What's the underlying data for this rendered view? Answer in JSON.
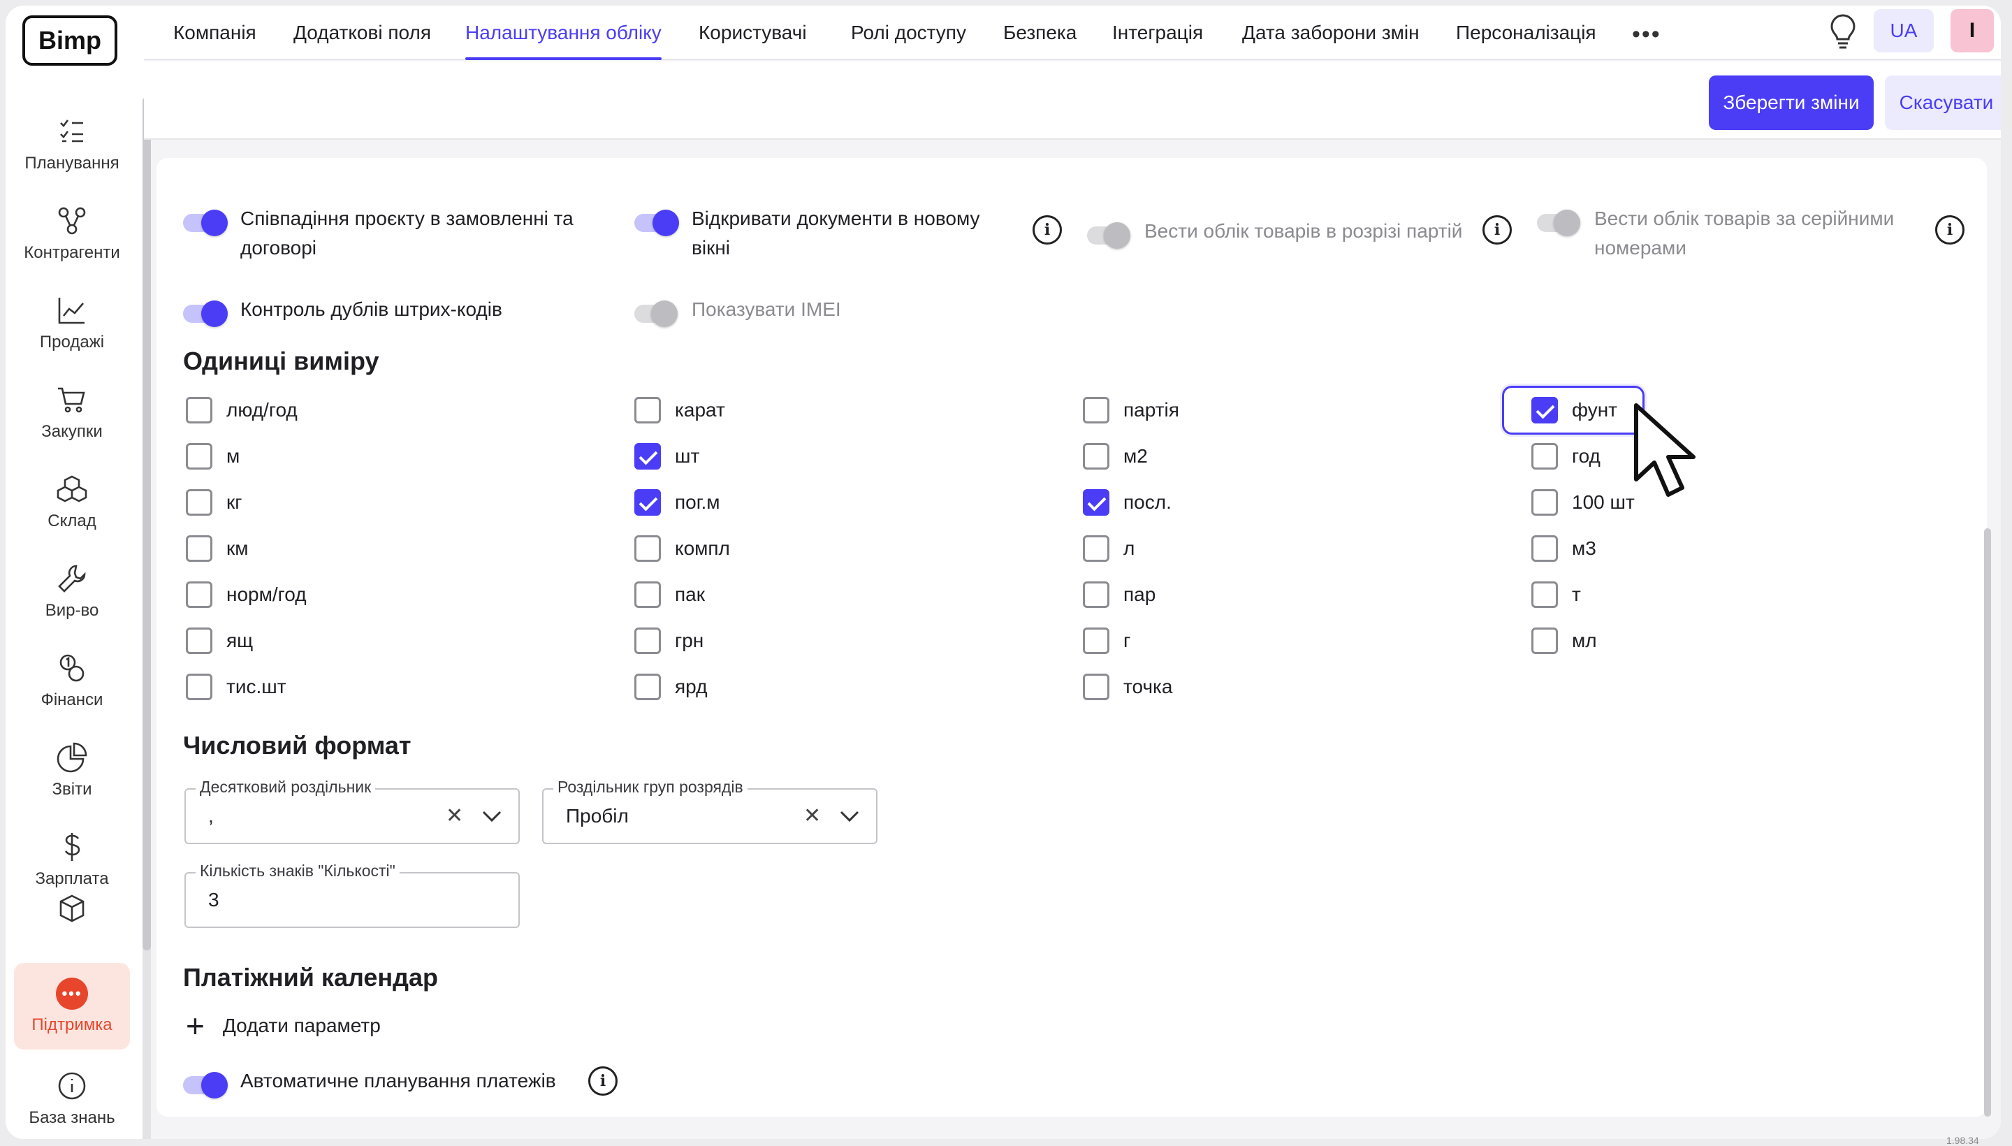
{
  "app": {
    "logo": "Bimp",
    "version": "1.98.34"
  },
  "sidebar": {
    "items": [
      {
        "label": "Планування",
        "icon": "checklist-icon"
      },
      {
        "label": "Контрагенти",
        "icon": "network-icon"
      },
      {
        "label": "Продажі",
        "icon": "chart-line-icon"
      },
      {
        "label": "Закупки",
        "icon": "cart-icon"
      },
      {
        "label": "Склад",
        "icon": "boxes-icon"
      },
      {
        "label": "Вир-во",
        "icon": "wrench-icon"
      },
      {
        "label": "Фінанси",
        "icon": "coins-icon"
      },
      {
        "label": "Звіти",
        "icon": "pie-chart-icon"
      },
      {
        "label": "Зарплата",
        "icon": "dollar-icon"
      },
      {
        "label": "",
        "icon": "cube-icon"
      }
    ],
    "support": {
      "label": "Підтримка",
      "icon": "chat-bubble-icon"
    },
    "knowledge": {
      "label": "База знань",
      "icon": "info-icon"
    }
  },
  "topnav": {
    "tabs": [
      {
        "label": "Компанія"
      },
      {
        "label": "Додаткові поля"
      },
      {
        "label": "Налаштування обліку"
      },
      {
        "label": "Користувачі"
      },
      {
        "label": "Ролі доступу"
      },
      {
        "label": "Безпека"
      },
      {
        "label": "Інтеграція"
      },
      {
        "label": "Дата заборони змін"
      },
      {
        "label": "Персоналізація"
      }
    ],
    "active_tab": "Налаштування обліку",
    "more": "•••",
    "lang": "UA",
    "avatar": "I"
  },
  "actions": {
    "save": "Зберегти зміни",
    "cancel": "Скасувати"
  },
  "toggles": [
    {
      "label": "Співпадіння проєкту в замовленні та договорі",
      "on": true,
      "disabled": false
    },
    {
      "label": "Відкривати документи в новому вікні",
      "on": true,
      "disabled": false,
      "info": true
    },
    {
      "label": "Вести облік товарів в розрізі партій",
      "on": false,
      "disabled": true,
      "info": true
    },
    {
      "label": "Вести облік товарів за серійними номерами",
      "on": false,
      "disabled": true,
      "info": true
    },
    {
      "label": "Контроль дублів штрих-кодів",
      "on": true,
      "disabled": false
    },
    {
      "label": "Показувати IMEI",
      "on": false,
      "disabled": true
    }
  ],
  "units": {
    "title": "Одиниці виміру",
    "columns": [
      [
        {
          "label": "люд/год",
          "checked": false
        },
        {
          "label": "м",
          "checked": false
        },
        {
          "label": "кг",
          "checked": false
        },
        {
          "label": "км",
          "checked": false
        },
        {
          "label": "норм/год",
          "checked": false
        },
        {
          "label": "ящ",
          "checked": false
        },
        {
          "label": "тис.шт",
          "checked": false
        }
      ],
      [
        {
          "label": "карат",
          "checked": false
        },
        {
          "label": "шт",
          "checked": true
        },
        {
          "label": "пог.м",
          "checked": true
        },
        {
          "label": "компл",
          "checked": false
        },
        {
          "label": "пак",
          "checked": false
        },
        {
          "label": "грн",
          "checked": false
        },
        {
          "label": "ярд",
          "checked": false
        }
      ],
      [
        {
          "label": "партія",
          "checked": false
        },
        {
          "label": "м2",
          "checked": false
        },
        {
          "label": "посл.",
          "checked": true
        },
        {
          "label": "л",
          "checked": false
        },
        {
          "label": "пар",
          "checked": false
        },
        {
          "label": "г",
          "checked": false
        },
        {
          "label": "точка",
          "checked": false
        }
      ],
      [
        {
          "label": "фунт",
          "checked": true
        },
        {
          "label": "год",
          "checked": false
        },
        {
          "label": "100 шт",
          "checked": false
        },
        {
          "label": "м3",
          "checked": false
        },
        {
          "label": "т",
          "checked": false
        },
        {
          "label": "мл",
          "checked": false
        }
      ]
    ]
  },
  "number_format": {
    "title": "Числовий формат",
    "decimal_separator": {
      "label": "Десятковий роздільник",
      "value": ","
    },
    "group_separator": {
      "label": "Роздільник груп розрядів",
      "value": "Пробіл"
    },
    "quantity_digits": {
      "label": "Кількість знаків \"Кількості\"",
      "value": "3"
    }
  },
  "payment_calendar": {
    "title": "Платіжний календар",
    "add_parameter": "Додати параметр",
    "auto_planning": {
      "label": "Автоматичне планування платежів",
      "on": true,
      "info": true
    }
  },
  "colors": {
    "accent": "#4a3df5",
    "accent_light": "#ecebfd",
    "support": "#e7462d",
    "avatar_bg": "#f8c3d2"
  }
}
